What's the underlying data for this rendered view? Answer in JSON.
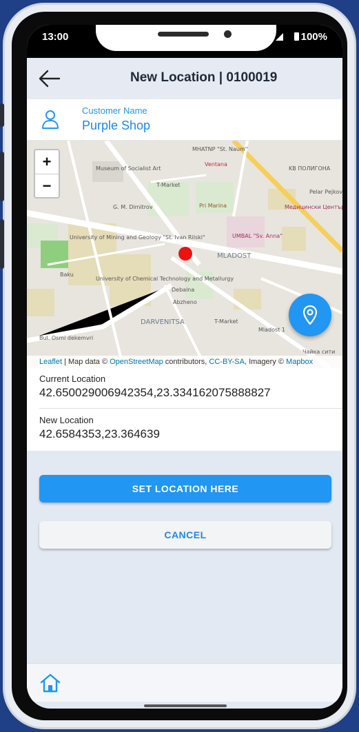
{
  "status": {
    "time": "13:00",
    "battery": "100%"
  },
  "appbar": {
    "title": "New Location | 0100019"
  },
  "customer": {
    "label": "Customer Name",
    "value": "Purple Shop"
  },
  "map": {
    "zoom_in": "+",
    "zoom_out": "−",
    "labels": [
      "MHATNP \"St. Naum\"",
      "Ventana",
      "KB ПОЛИГОНА",
      "Museum of Socialist Art",
      "T-Market",
      "Медицински Център Кармония",
      "Pelar Pejkov",
      "G. M. Dimitrov",
      "Pri Marina",
      "UMBAL \"Sv. Anna\"",
      "MLADOST",
      "University of Mining and Geology \"St. Ivan Rilski\"",
      "University of Chemical Technology and Metallurgy",
      "Baku",
      "Debalna",
      "Abzheno",
      "DARVENITSA",
      "T-Market",
      "Mladost 1",
      "Чайка сити",
      "Bul. Osmi dekemvri"
    ],
    "attribution": {
      "leaflet": "Leaflet",
      "sep1": " | Map data © ",
      "osm": "OpenStreetMap",
      "sep2": " contributors, ",
      "license": "CC-BY-SA",
      "sep3": ", Imagery © ",
      "mapbox": "Mapbox"
    }
  },
  "info": {
    "current_label": "Current Location",
    "current_value": "42.650029006942354,23.334162075888827",
    "new_label": "New Location",
    "new_value": "42.6584353,23.364639"
  },
  "actions": {
    "set_label": "SET LOCATION HERE",
    "cancel_label": "CANCEL"
  },
  "icons": {
    "back": "arrow-left-icon",
    "person": "person-icon",
    "fab": "map-pin-icon",
    "home": "home-icon"
  },
  "colors": {
    "accent": "#2196f3",
    "marker": "#ee1111",
    "frame": "#1f3f86"
  }
}
